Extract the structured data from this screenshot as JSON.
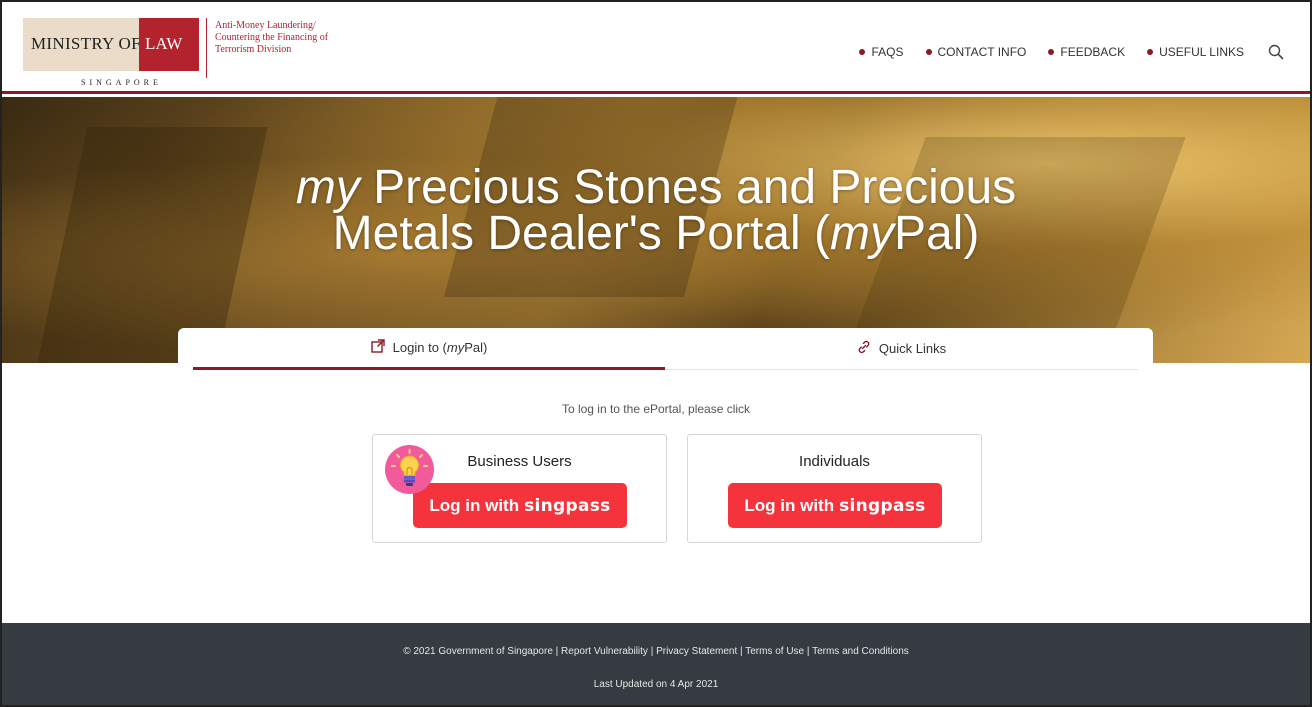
{
  "header": {
    "logo": {
      "ministry": "MINISTRY OF",
      "law": "LAW",
      "country": "SINGAPORE",
      "division_lines": [
        "Anti-Money Laundering/",
        "Countering the Financing of",
        "Terrorism Division"
      ]
    },
    "nav": [
      {
        "label": "FAQS"
      },
      {
        "label": "CONTACT INFO"
      },
      {
        "label": "FEEDBACK"
      },
      {
        "label": "USEFUL LINKS"
      }
    ]
  },
  "hero": {
    "title_prefix": "my",
    "title_line1_rest": " Precious Stones and Precious",
    "title_line2_start": "Metals Dealer's Portal (",
    "title_line2_italic": "my",
    "title_line2_end": "Pal)"
  },
  "tabs": {
    "login": {
      "prefix": "Login to (",
      "italic": "my",
      "suffix": "Pal)"
    },
    "quick_links": "Quick Links"
  },
  "instruction": "To log in to the ePortal, please click",
  "cards": [
    {
      "title": "Business Users",
      "button_prefix": "Log in with",
      "button_brand": "singpass"
    },
    {
      "title": "Individuals",
      "button_prefix": "Log in with",
      "button_brand": "singpass"
    }
  ],
  "footer": {
    "links_line": "© 2021 Government of Singapore | Report Vulnerability | Privacy Statement | Terms of Use | Terms and Conditions",
    "last_updated": "Last Updated on 4 Apr 2021"
  },
  "colors": {
    "brand_red": "#8b1a24",
    "singpass_red": "#f4333d",
    "footer_bg": "#353b41"
  },
  "icons": [
    "search-icon",
    "external-link-icon",
    "link-icon",
    "lightbulb-icon"
  ]
}
